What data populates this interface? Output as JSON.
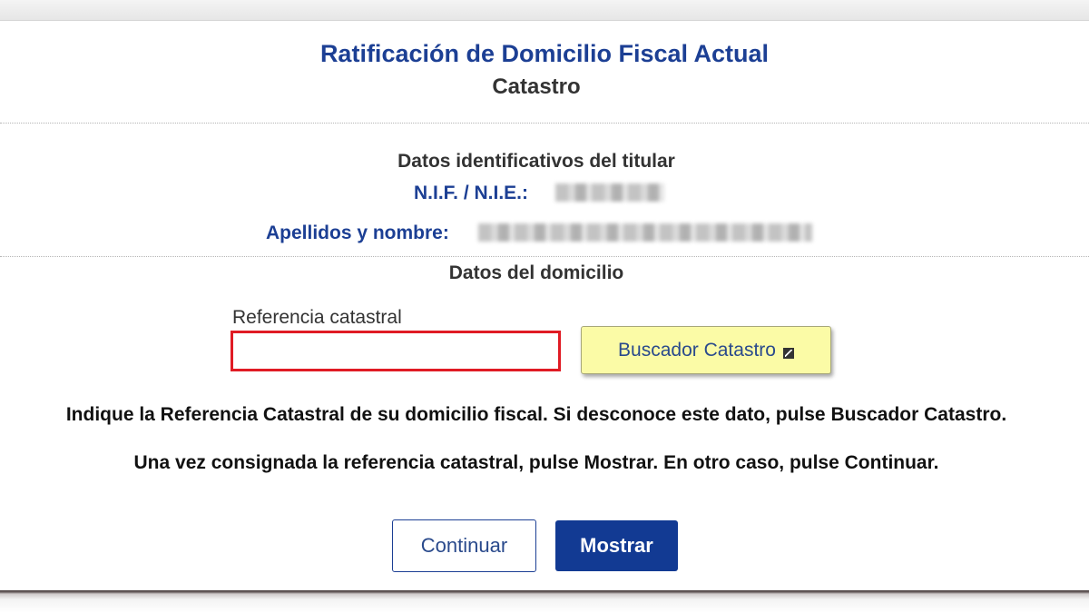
{
  "header": {
    "title": "Ratificación de Domicilio Fiscal Actual",
    "subtitle": "Catastro"
  },
  "titular": {
    "heading": "Datos identificativos del titular",
    "nif_label": "N.I.F. / N.I.E.:",
    "name_label": "Apellidos y nombre:"
  },
  "domicilio": {
    "heading": "Datos del domicilio",
    "ref_label": "Referencia catastral",
    "ref_value": "",
    "buscador_label": "Buscador Catastro",
    "buscador_icon": "external-link-icon"
  },
  "instructions": {
    "line1": "Indique la Referencia Catastral de su domicilio fiscal. Si desconoce este dato, pulse Buscador Catastro.",
    "line2": "Una vez consignada la referencia catastral, pulse Mostrar. En otro caso, pulse Continuar."
  },
  "actions": {
    "continuar_label": "Continuar",
    "mostrar_label": "Mostrar"
  },
  "colors": {
    "title_blue": "#1c3f94",
    "primary_button": "#123a93",
    "buscador_bg": "#fbfba6",
    "input_border": "#e01b24"
  }
}
